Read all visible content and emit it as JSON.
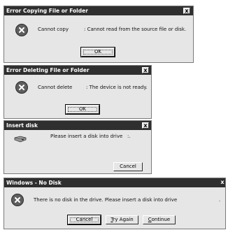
{
  "dialog_copy": {
    "title": "Error Copying File or Folder",
    "close": "x",
    "message_part1": "Cannot copy",
    "message_part2": ": Cannot read from the source file or disk.",
    "ok": "OK"
  },
  "dialog_delete": {
    "title": "Error Deleting File or Folder",
    "close": "x",
    "message_part1": "Cannot delete",
    "message_part2": ": The device is not ready.",
    "ok": "OK"
  },
  "dialog_insert": {
    "title": "Insert disk",
    "close": "x",
    "message": "Please insert a disk into drive   :.",
    "cancel": "Cancel"
  },
  "dialog_nodisk": {
    "title": "Windows - No Disk",
    "close": "x",
    "message": "There is no disk in the drive. Please insert a disk into drive",
    "trailing_mark": ".",
    "cancel": "Cancel",
    "try_again_underlined": "T",
    "try_again_rest": "ry Again",
    "continue_underlined": "C",
    "continue_rest": "ontinue"
  }
}
